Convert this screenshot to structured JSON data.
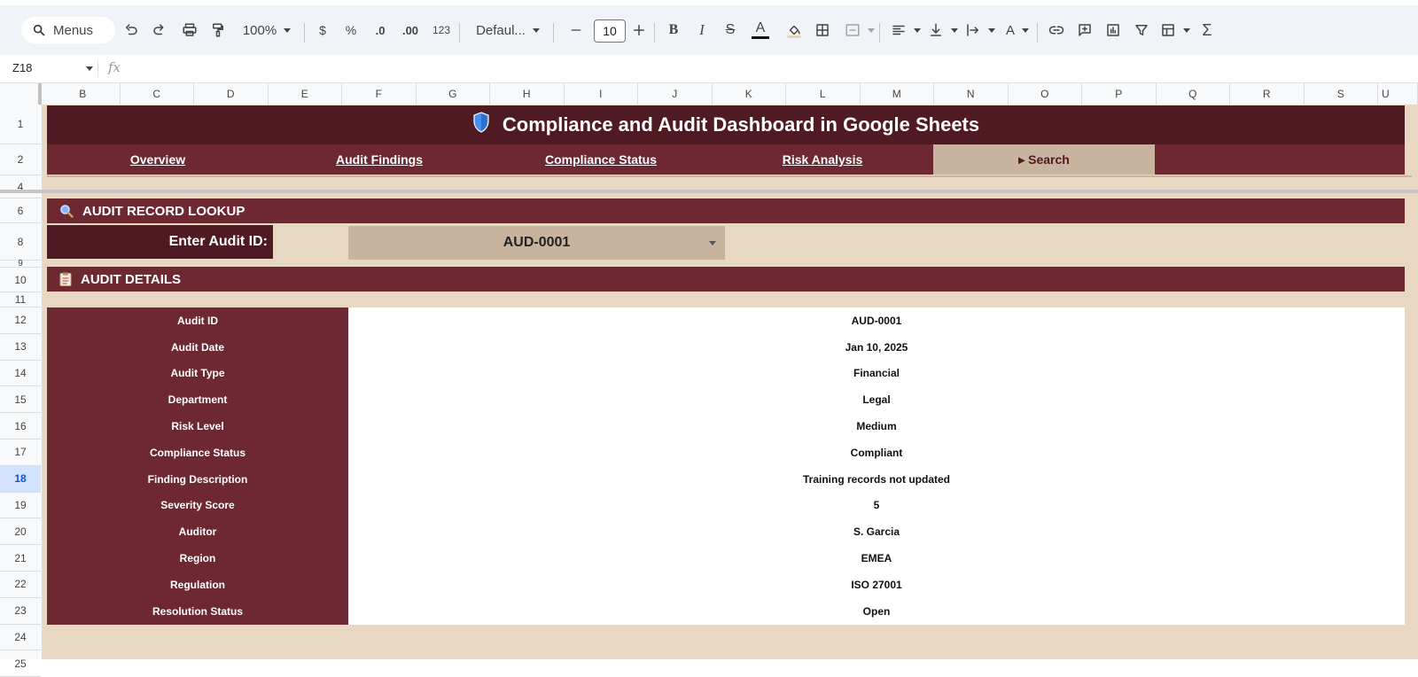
{
  "toolbar": {
    "search_label": "Menus",
    "zoom": "100%",
    "currency": "$",
    "percent": "%",
    "decrease_decimal": ".0",
    "increase_decimal": ".00",
    "number_format": "123",
    "font": "Defaul...",
    "font_size": "10"
  },
  "formula_bar": {
    "cell_ref": "Z18",
    "fx": "fx"
  },
  "columns": [
    "B",
    "C",
    "D",
    "E",
    "F",
    "G",
    "H",
    "I",
    "J",
    "K",
    "L",
    "M",
    "N",
    "O",
    "P",
    "Q",
    "R",
    "S",
    "U"
  ],
  "rows": [
    "1",
    "2",
    "4",
    "6",
    "8",
    "9",
    "10",
    "11",
    "12",
    "13",
    "14",
    "15",
    "16",
    "17",
    "18",
    "19",
    "20",
    "21",
    "22",
    "23",
    "24",
    "25"
  ],
  "active_row": "18",
  "dashboard": {
    "title": "Compliance and Audit Dashboard in Google Sheets",
    "nav": [
      "Overview",
      "Audit Findings",
      "Compliance Status",
      "Risk Analysis",
      "▸ Search"
    ],
    "lookup_section": "AUDIT RECORD LOOKUP",
    "enter_label": "Enter Audit ID:",
    "selected_audit_id": "AUD-0001",
    "details_section": "AUDIT DETAILS",
    "details": [
      {
        "label": "Audit ID",
        "value": "AUD-0001"
      },
      {
        "label": "Audit Date",
        "value": "Jan 10, 2025"
      },
      {
        "label": "Audit Type",
        "value": "Financial"
      },
      {
        "label": "Department",
        "value": "Legal"
      },
      {
        "label": "Risk Level",
        "value": "Medium"
      },
      {
        "label": "Compliance Status",
        "value": "Compliant"
      },
      {
        "label": "Finding Description",
        "value": "Training records not updated"
      },
      {
        "label": "Severity Score",
        "value": "5"
      },
      {
        "label": "Auditor",
        "value": "S. Garcia"
      },
      {
        "label": "Region",
        "value": "EMEA"
      },
      {
        "label": "Regulation",
        "value": "ISO 27001"
      },
      {
        "label": "Resolution Status",
        "value": "Open"
      }
    ]
  },
  "colors": {
    "banner": "#4f1a22",
    "section": "#6d2832",
    "background": "#e8d7c3",
    "accent": "#c8b39e"
  }
}
